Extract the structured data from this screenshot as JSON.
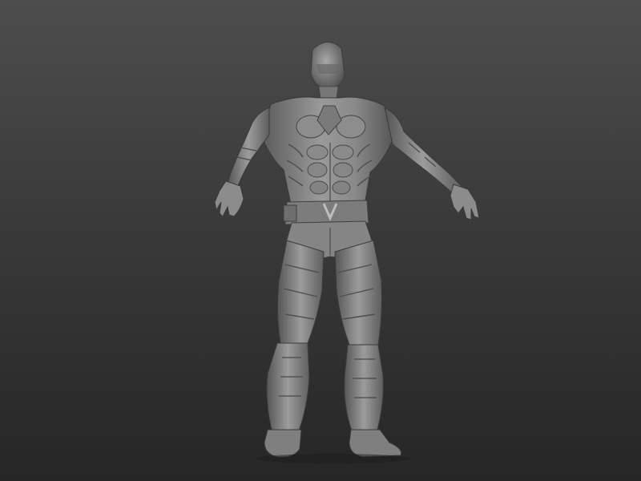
{
  "viewport": {
    "background_top": "#4d4d4d",
    "background_bottom": "#262626",
    "model_color": "#8f8f8f",
    "model_shadow": "#4a4a4a",
    "model_highlight": "#b4b4b4"
  },
  "model": {
    "subject": "armored-humanoid-sculpt",
    "pose": "a-pose"
  }
}
